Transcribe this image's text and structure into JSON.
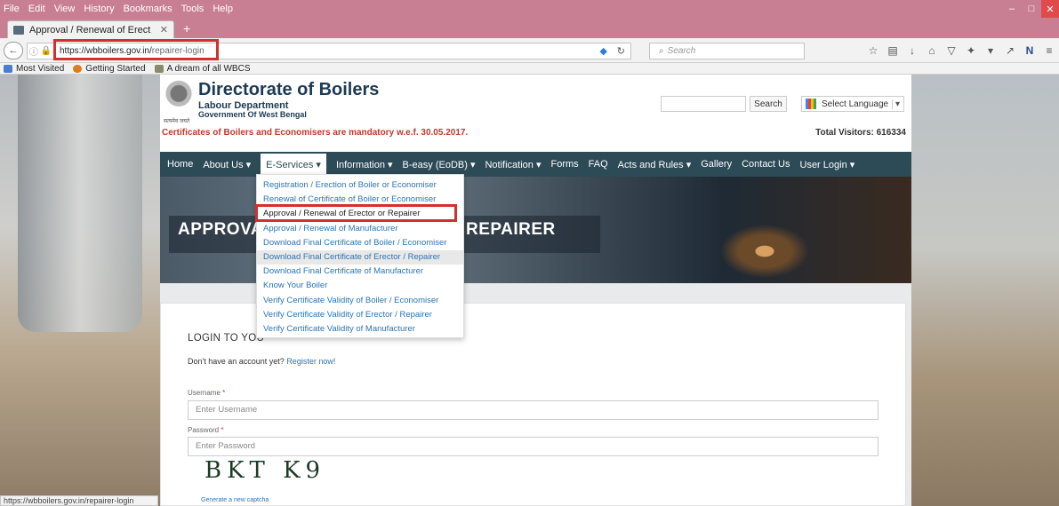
{
  "menubar": {
    "items": [
      "File",
      "Edit",
      "View",
      "History",
      "Bookmarks",
      "Tools",
      "Help"
    ]
  },
  "tab": {
    "title": "Approval / Renewal of Erect"
  },
  "address": {
    "host": "https://wbboilers.gov.in/",
    "path": "repairer-login"
  },
  "browser_search": {
    "placeholder": "Search"
  },
  "bookmarks": [
    "Most Visited",
    "Getting Started",
    "A dream of all WBCS"
  ],
  "site": {
    "title": "Directorate of Boilers",
    "dept": "Labour Department",
    "gov": "Government Of West Bengal",
    "emblem_caption": "सत्यमेव जयते",
    "notice": "Certificates of Boilers and Economisers are mandatory w.e.f. 30.05.2017.",
    "visitors": "Total Visitors: 616334",
    "search_btn": "Search",
    "language": "Select Language"
  },
  "nav": [
    "Home",
    "About Us ▾",
    "E-Services ▾",
    "Information ▾",
    "B-easy (EoDB) ▾",
    "Notification ▾",
    "Forms",
    "FAQ",
    "Acts and Rules ▾",
    "Gallery",
    "Contact Us",
    "User Login ▾"
  ],
  "dropdown": [
    "Registration / Erection of Boiler or Economiser",
    "Renewal of Certificate of Boiler or Economiser",
    "Approval / Renewal of Erector or Repairer",
    "Approval / Renewal of Manufacturer",
    "Download Final Certificate of Boiler / Economiser",
    "Download Final Certificate of Erector / Repairer",
    "Download Final Certificate of Manufacturer",
    "Know Your Boiler",
    "Verify Certificate Validity of Boiler / Economiser",
    "Verify Certificate Validity of Erector / Repairer",
    "Verify Certificate Validity of Manufacturer"
  ],
  "hero": {
    "text": "APPROVA                              R OR REPAIRER"
  },
  "login": {
    "title": "LOGIN TO YOU",
    "no_account": "Don't have an account yet?",
    "register": "Register now!",
    "username_label": "Username",
    "username_placeholder": "Enter Username",
    "password_label": "Password",
    "password_placeholder": "Enter Password",
    "captcha": "BKT K9",
    "captcha_link": "Generate a new captcha"
  },
  "status_url": "https://wbboilers.gov.in/repairer-login"
}
